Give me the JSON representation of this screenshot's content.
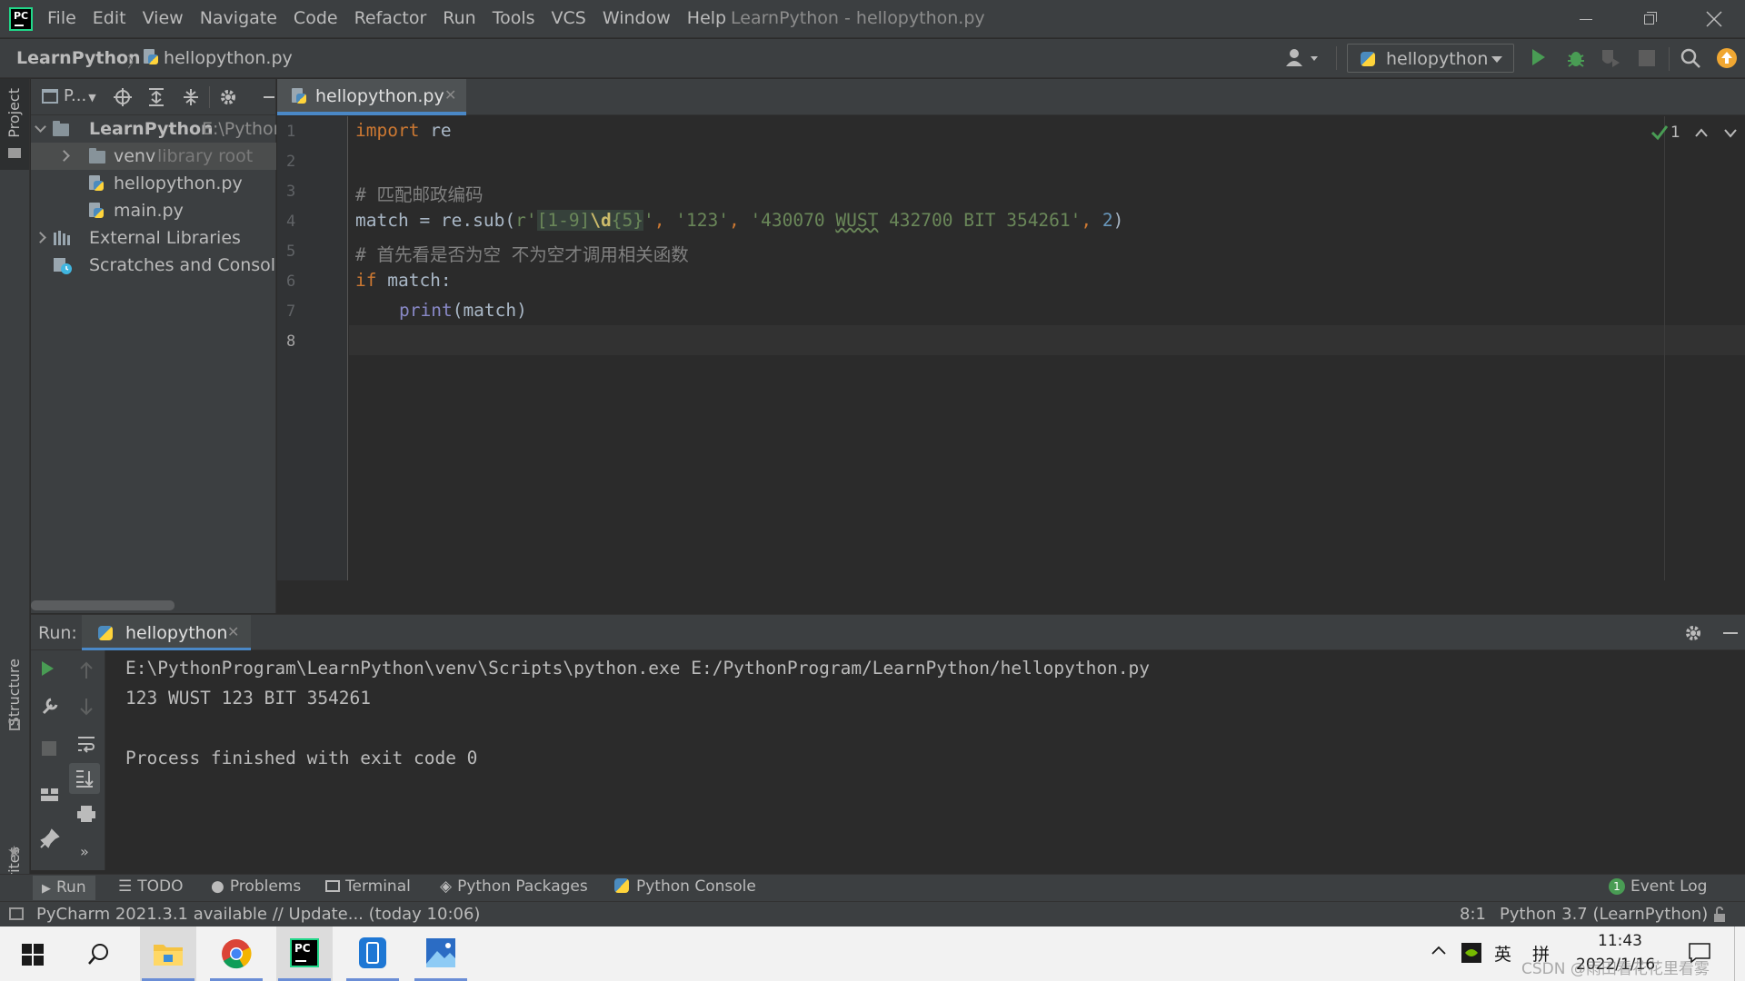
{
  "window": {
    "title": "LearnPython - hellopython.py",
    "menu": [
      "File",
      "Edit",
      "View",
      "Navigate",
      "Code",
      "Refactor",
      "Run",
      "Tools",
      "VCS",
      "Window",
      "Help"
    ],
    "logo_text": "PC"
  },
  "navbar": {
    "project": "LearnPython",
    "file": "hellopython.py",
    "run_config": "hellopython"
  },
  "left_stripe": {
    "project_label": "Project",
    "structure_label": "Structure",
    "favorites_label": "Favorites"
  },
  "project_panel": {
    "title": "P...",
    "tree": [
      {
        "label": "LearnPython",
        "hint": "E:\\Python",
        "type": "folder",
        "expanded": true
      },
      {
        "label": "venv",
        "hint": "library root",
        "type": "folder",
        "expanded": false
      },
      {
        "label": "hellopython.py",
        "hint": "",
        "type": "python-file"
      },
      {
        "label": "main.py",
        "hint": "",
        "type": "python-file"
      },
      {
        "label": "External Libraries",
        "hint": "",
        "type": "libraries",
        "expanded": false
      },
      {
        "label": "Scratches and Consoles",
        "hint": "",
        "type": "scratches"
      }
    ]
  },
  "editor": {
    "tab": "hellopython.py",
    "line_numbers": [
      "1",
      "2",
      "3",
      "4",
      "5",
      "6",
      "7",
      "8"
    ],
    "inspection_count": "1",
    "code": {
      "l1_kw": "import",
      "l1_rest": " re",
      "l3_comment": "# 匹配邮政编码",
      "l4_pre": "match = re.sub(",
      "l4_r": "r'",
      "l4_rx1": "[1-9]",
      "l4_rx2": "\\d",
      "l4_rx3": "{5}",
      "l4_q": "'",
      "l4_sep1": ", ",
      "l4_s2": "'123'",
      "l4_sep2": ", ",
      "l4_s3a": "'430070 ",
      "l4_s3b": "WUST",
      "l4_s3c": " 432700 BIT 354261'",
      "l4_sep3": ", ",
      "l4_num": "2",
      "l4_close": ")",
      "l5_comment": "# 首先看是否为空 不为空才调用相关函数",
      "l6_kw": "if",
      "l6_rest": " match:",
      "l7_fn": "print",
      "l7_rest": "(match)"
    }
  },
  "run_panel": {
    "label": "Run:",
    "tab": "hellopython",
    "output": [
      "E:\\PythonProgram\\LearnPython\\venv\\Scripts\\python.exe E:/PythonProgram/LearnPython/hellopython.py",
      "123 WUST 123 BIT 354261",
      "",
      "Process finished with exit code 0"
    ]
  },
  "bottom_tabs": {
    "run": "Run",
    "todo": "TODO",
    "problems": "Problems",
    "terminal": "Terminal",
    "packages": "Python Packages",
    "console": "Python Console",
    "event_log": "Event Log",
    "event_count": "1"
  },
  "statusbar": {
    "message": "PyCharm 2021.3.1 available // Update... (today 10:06)",
    "position": "8:1",
    "interpreter": "Python 3.7 (LearnPython)"
  },
  "taskbar": {
    "ime_lang": "英",
    "ime_mode": "拼",
    "time": "11:43",
    "date": "2022/1/16",
    "watermark": "CSDN @雨田看花花里看雾",
    "apps": [
      "windows-start",
      "search",
      "file-explorer",
      "chrome",
      "pycharm",
      "phone-app",
      "photos"
    ]
  },
  "colors": {
    "accent": "#4a88c7",
    "run_green": "#499c54",
    "keyword": "#cc7832",
    "string": "#6a8759",
    "comment": "#808080",
    "number": "#6897bb"
  }
}
